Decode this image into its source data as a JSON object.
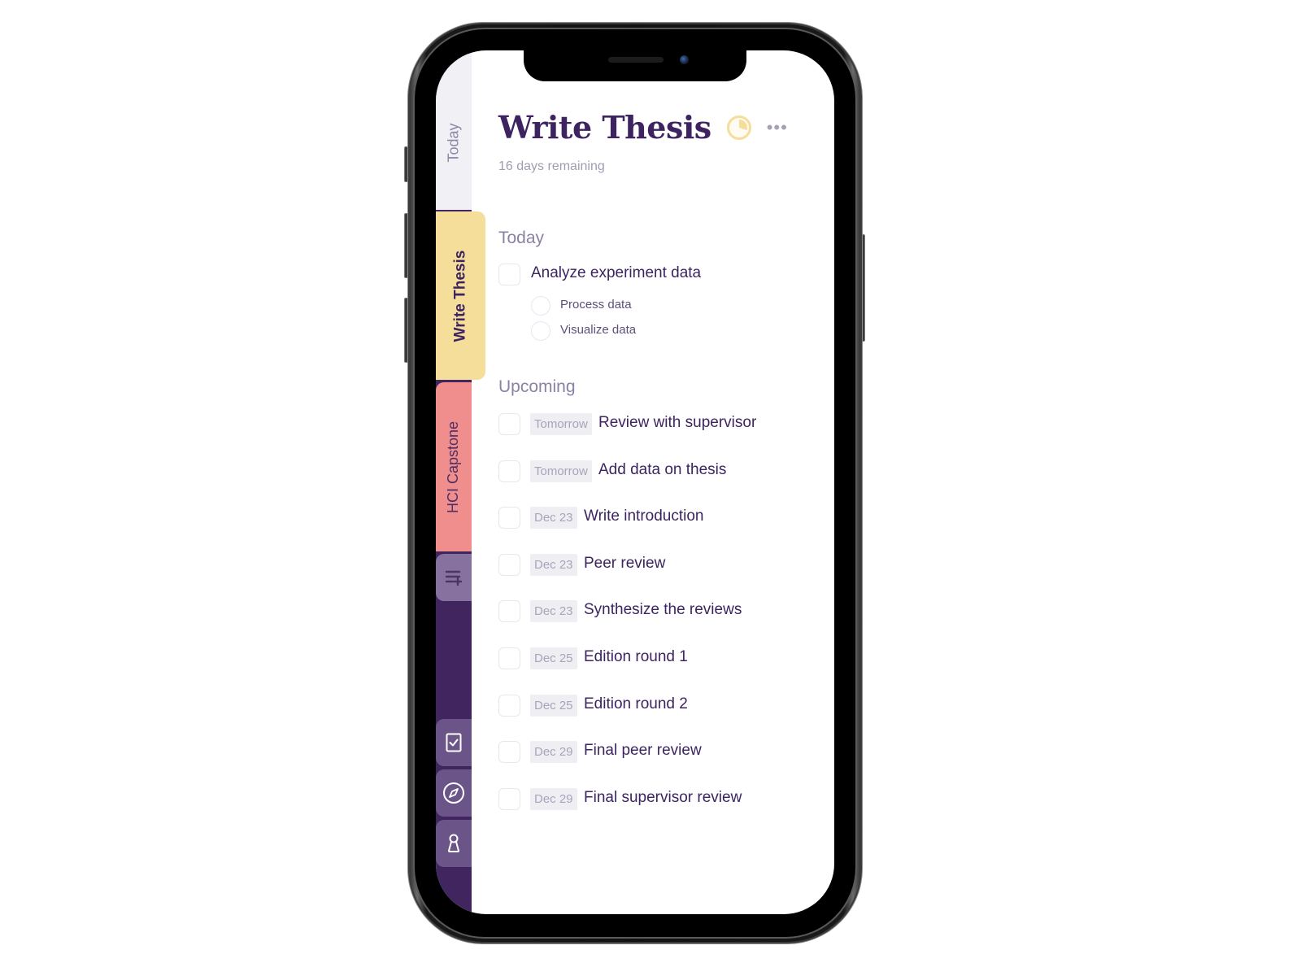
{
  "sidebar": {
    "tabs": [
      {
        "label": "Today",
        "color": "#f1f0f4"
      },
      {
        "label": "Write Thesis",
        "color": "#f5dd9a",
        "active": true
      },
      {
        "label": "HCI Capstone",
        "color": "#f08d8d"
      }
    ],
    "add_list_icon": "playlist-add-icon",
    "nav": [
      {
        "name": "tasks",
        "icon": "checkbox-icon"
      },
      {
        "name": "explore",
        "icon": "compass-icon"
      },
      {
        "name": "profile",
        "icon": "person-icon"
      }
    ]
  },
  "header": {
    "title": "Write Thesis",
    "progress_fraction": 0.3,
    "progress_color": "#f5dd9a",
    "more_label": "•••",
    "subtitle": "16 days remaining"
  },
  "today": {
    "title": "Today",
    "tasks": [
      {
        "label": "Analyze experiment data",
        "subtasks": [
          {
            "label": "Process data"
          },
          {
            "label": "Visualize data"
          }
        ]
      }
    ]
  },
  "upcoming": {
    "title": "Upcoming",
    "tasks": [
      {
        "date": "Tomorrow",
        "label": "Review with supervisor"
      },
      {
        "date": "Tomorrow",
        "label": "Add data on thesis"
      },
      {
        "date": "Dec 23",
        "label": "Write introduction"
      },
      {
        "date": "Dec 23",
        "label": "Peer review"
      },
      {
        "date": "Dec 23",
        "label": "Synthesize the reviews"
      },
      {
        "date": "Dec 25",
        "label": "Edition round 1"
      },
      {
        "date": "Dec 25",
        "label": "Edition round 2"
      },
      {
        "date": "Dec 29",
        "label": "Final peer review"
      },
      {
        "date": "Dec 29",
        "label": "Final supervisor review"
      }
    ]
  },
  "colors": {
    "brand_purple": "#40255f",
    "text_primary": "#3d2461",
    "text_muted": "#8b81a3"
  }
}
